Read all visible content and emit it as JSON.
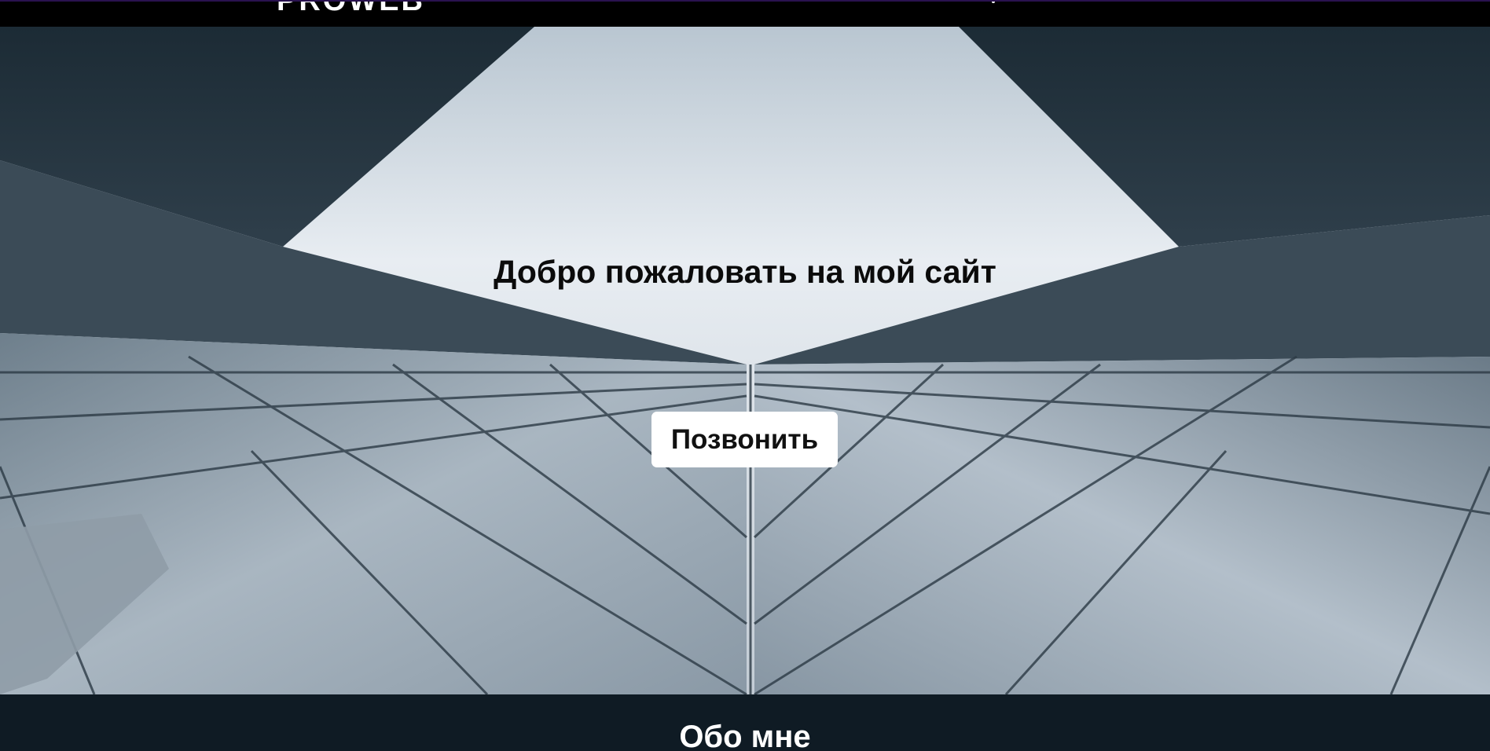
{
  "header": {
    "logo_text": "PROWEB"
  },
  "hero": {
    "background_image": "glass-skyscraper-upward-view",
    "title": "Добро пожаловать на мой сайт",
    "cta_label": "Позвонить"
  },
  "about": {
    "title": "Обо мне"
  },
  "colors": {
    "header_bg": "#000000",
    "section_bg": "#0f1b24",
    "button_bg": "#ffffff",
    "title_text": "#0b0b0b"
  }
}
